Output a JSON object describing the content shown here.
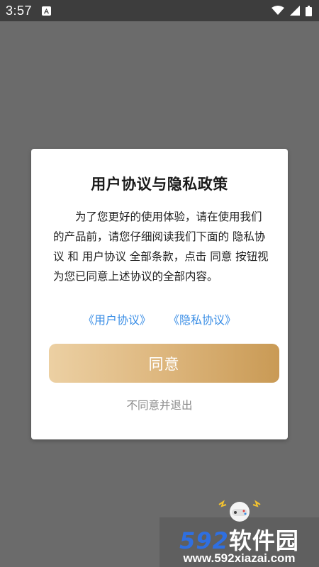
{
  "status_bar": {
    "time": "3:57",
    "notification_icon": "a-icon",
    "icons": [
      "wifi-icon",
      "cell-signal-icon",
      "battery-icon"
    ]
  },
  "dialog": {
    "title": "用户协议与隐私政策",
    "body": "为了您更好的使用体验，请在使用我们的产品前，请您仔细阅读我们下面的 隐私协议 和 用户协议 全部条款，点击 同意 按钮视为您已同意上述协议的全部内容。",
    "link_user_agreement": "《用户协议》",
    "link_privacy_policy": "《隐私协议》",
    "agree_button": "同意",
    "disagree_link": "不同意并退出"
  },
  "colors": {
    "link": "#3a8ee6",
    "button_gradient_start": "#ecd0a3",
    "button_gradient_end": "#c99a55",
    "overlay": "#6b6b6b"
  },
  "watermark": {
    "brand_number": "592",
    "brand_text": "软件园",
    "url": "www.592xiazai.com"
  }
}
